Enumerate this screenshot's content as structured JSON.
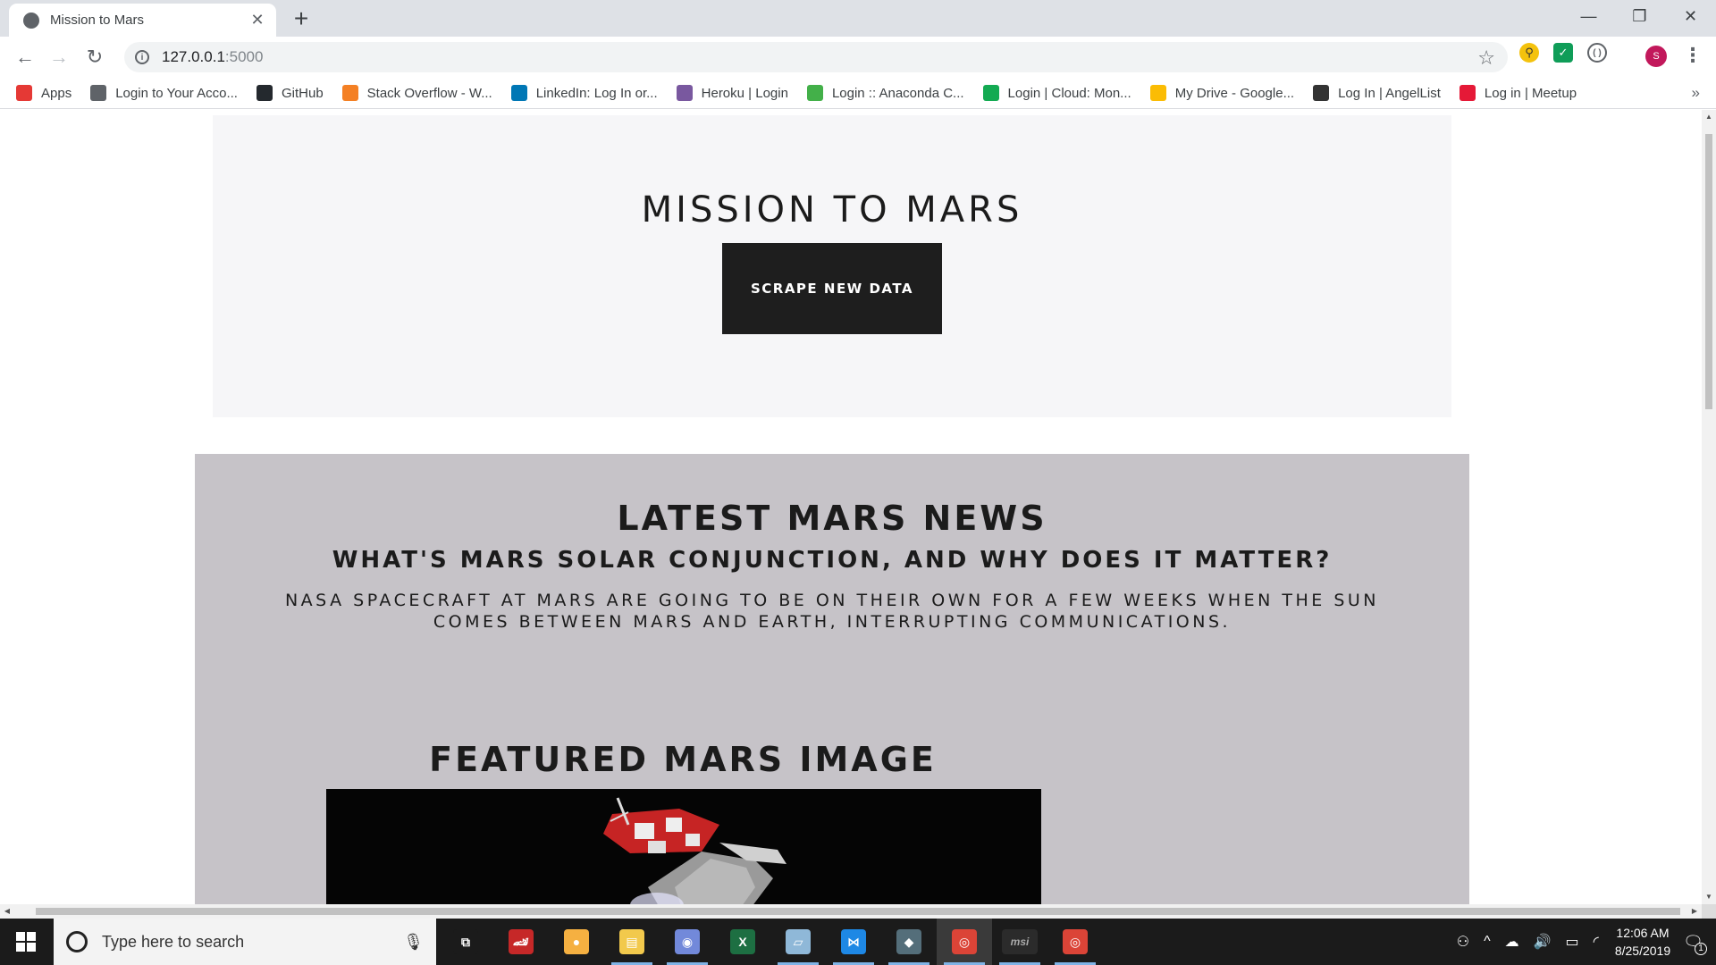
{
  "browser": {
    "tab_title": "Mission to Mars",
    "url_host": "127.0.0.1",
    "url_port": ":5000",
    "avatar_letter": "S",
    "bookmarks": [
      {
        "label": "Apps",
        "icon": "apps-grid-icon",
        "color": "#e53935"
      },
      {
        "label": "Login to Your Acco...",
        "icon": "globe-icon",
        "color": "#5f6368"
      },
      {
        "label": "GitHub",
        "icon": "github-icon",
        "color": "#24292e"
      },
      {
        "label": "Stack Overflow - W...",
        "icon": "stackoverflow-icon",
        "color": "#f48024"
      },
      {
        "label": "LinkedIn: Log In or...",
        "icon": "linkedin-icon",
        "color": "#0077b5"
      },
      {
        "label": "Heroku | Login",
        "icon": "heroku-icon",
        "color": "#79589f"
      },
      {
        "label": "Login :: Anaconda C...",
        "icon": "anaconda-icon",
        "color": "#43b049"
      },
      {
        "label": "Login | Cloud: Mon...",
        "icon": "mongodb-leaf-icon",
        "color": "#13aa52"
      },
      {
        "label": "My Drive - Google...",
        "icon": "google-drive-icon",
        "color": "#fbbc04"
      },
      {
        "label": "Log In | AngelList",
        "icon": "angellist-icon",
        "color": "#333333"
      },
      {
        "label": "Log in | Meetup",
        "icon": "meetup-icon",
        "color": "#e51937"
      }
    ]
  },
  "page": {
    "title": "MISSION TO MARS",
    "scrape_button": "SCRAPE NEW DATA",
    "news_heading": "LATEST MARS NEWS",
    "news_title": "WHAT'S MARS SOLAR CONJUNCTION, AND WHY DOES IT MATTER?",
    "news_paragraph": "NASA SPACECRAFT AT MARS ARE GOING TO BE ON THEIR OWN FOR A FEW WEEKS WHEN THE SUN COMES BETWEEN MARS AND EARTH, INTERRUPTING COMMUNICATIONS.",
    "featured_heading": "FEATURED MARS IMAGE"
  },
  "taskbar": {
    "search_placeholder": "Type here to search",
    "time": "12:06 AM",
    "date": "8/25/2019",
    "notification_count": "1",
    "apps": [
      {
        "name": "task-view",
        "color": "#1b1b1b",
        "glyph": "⧉"
      },
      {
        "name": "red-car-app",
        "color": "#c62828",
        "glyph": "🏎"
      },
      {
        "name": "anaconda-navigator",
        "color": "#f5b041",
        "glyph": "●"
      },
      {
        "name": "file-explorer",
        "color": "#f2c94c",
        "glyph": "▤"
      },
      {
        "name": "discord",
        "color": "#7289da",
        "glyph": "◉"
      },
      {
        "name": "excel",
        "color": "#1d6f42",
        "glyph": "X"
      },
      {
        "name": "paper-app",
        "color": "#8fb8d8",
        "glyph": "▱"
      },
      {
        "name": "vscode",
        "color": "#1e88e5",
        "glyph": "⋈"
      },
      {
        "name": "git-kraken",
        "color": "#546e7a",
        "glyph": "◆"
      },
      {
        "name": "chrome",
        "color": "#db4437",
        "glyph": "◎"
      },
      {
        "name": "msi-app",
        "color": "#2b2b2b",
        "glyph": "msi"
      },
      {
        "name": "chrome-2",
        "color": "#db4437",
        "glyph": "◎"
      }
    ]
  }
}
